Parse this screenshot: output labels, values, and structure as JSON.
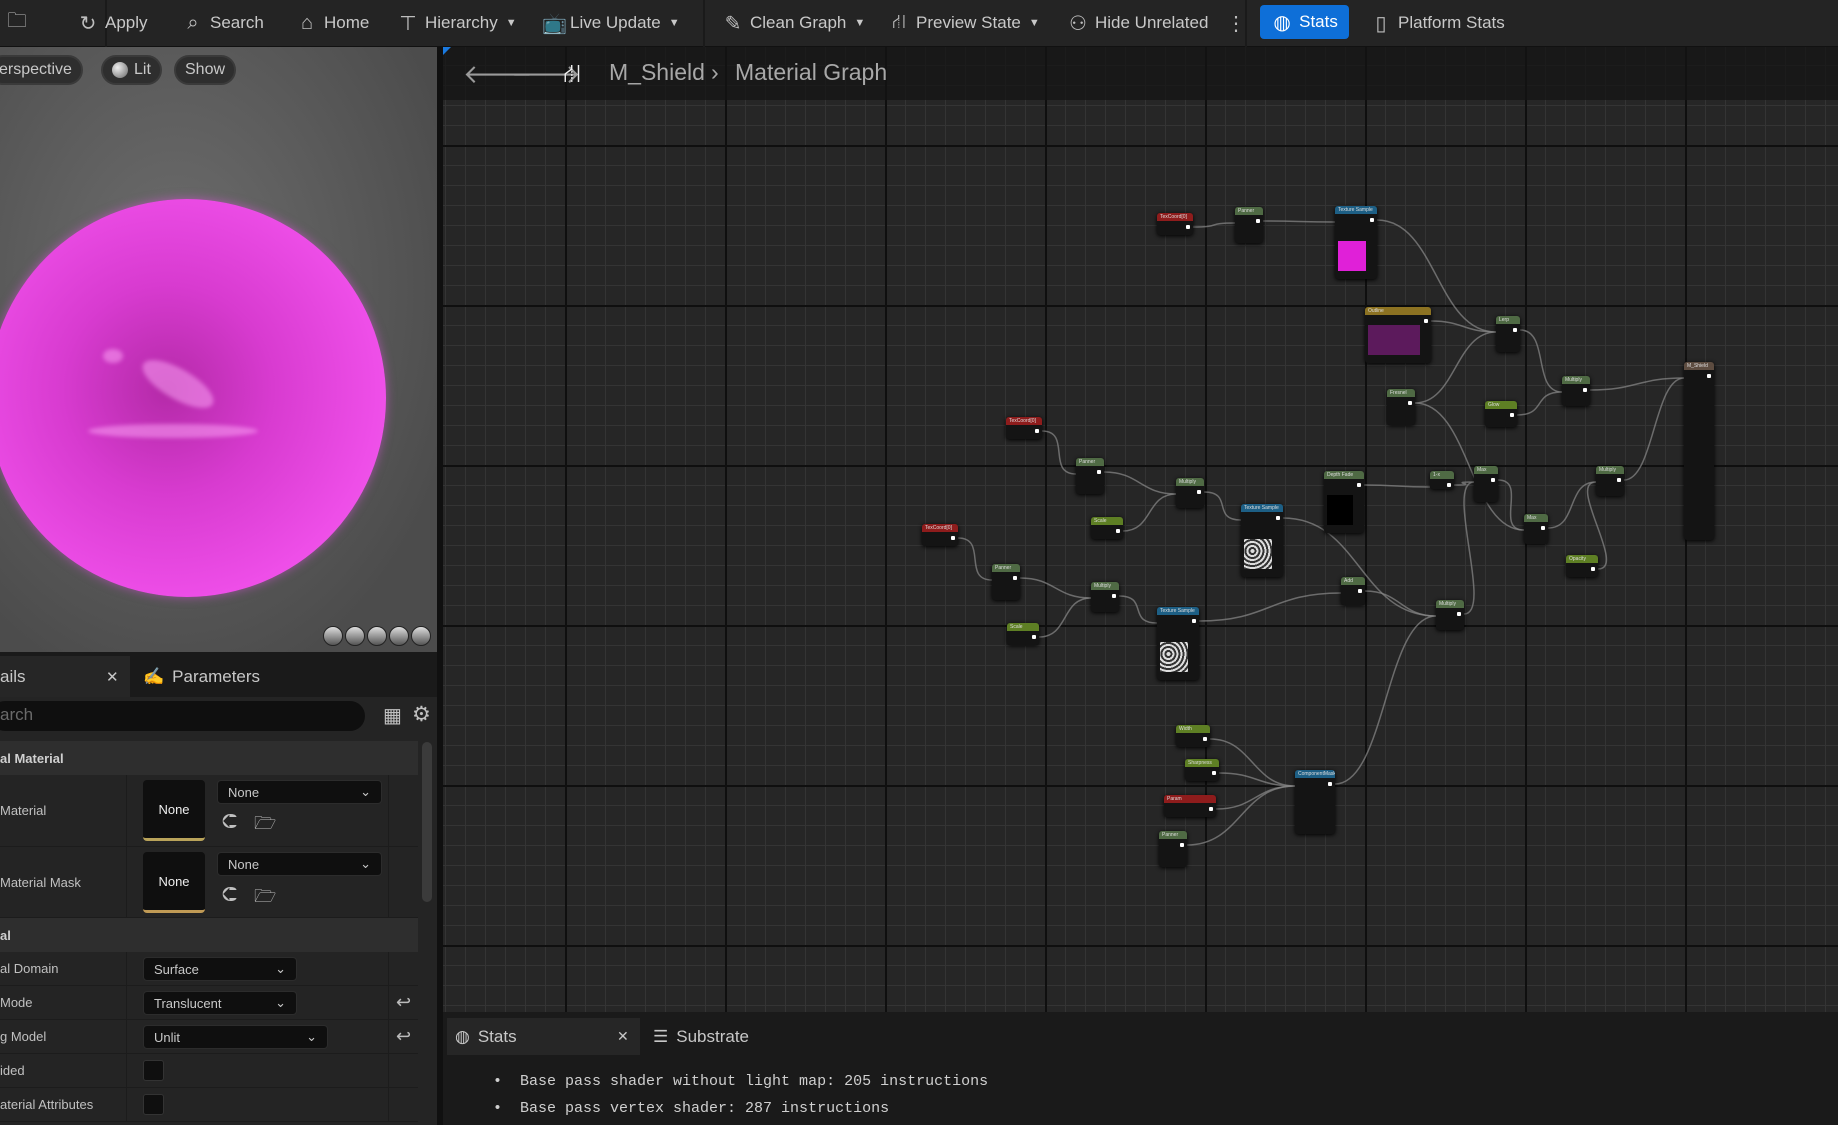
{
  "toolbar": {
    "apply": "Apply",
    "search": "Search",
    "home": "Home",
    "hierarchy": "Hierarchy",
    "live_update": "Live Update",
    "clean_graph": "Clean Graph",
    "preview_state": "Preview State",
    "hide_unrelated": "Hide Unrelated",
    "stats": "Stats",
    "platform_stats": "Platform Stats"
  },
  "viewport": {
    "perspective": "erspective",
    "lit": "Lit",
    "show": "Show"
  },
  "details": {
    "tab_details": "ails",
    "tab_parameters": "Parameters",
    "search_placeholder": "arch",
    "section1": "al Material",
    "row_material": "Material",
    "row_material_value": "None",
    "row_material_thumb": "None",
    "row_mask": "Material Mask",
    "row_mask_value": "None",
    "row_mask_thumb": "None",
    "section2": "al",
    "domain_label": "al Domain",
    "domain_value": "Surface",
    "blend_label": "Mode",
    "blend_value": "Translucent",
    "shading_label": "g Model",
    "shading_value": "Unlit",
    "twosided_label": "ided",
    "attrs_label": "aterial Attributes"
  },
  "graph": {
    "asset": "M_Shield",
    "title": "Material Graph",
    "nodes": [
      {
        "title": "TexCoord[0]",
        "kind": "red"
      },
      {
        "title": "Panner",
        "kind": "green"
      },
      {
        "title": "Texture Sample",
        "kind": "blue",
        "preview": "#e020d8"
      },
      {
        "title": "Outline",
        "kind": "gold",
        "preview": "#5c1a5c"
      },
      {
        "title": "Lerp",
        "kind": "green"
      },
      {
        "title": "Fresnel",
        "kind": "green"
      },
      {
        "title": "Glow",
        "kind": "lime"
      },
      {
        "title": "Multiply",
        "kind": "green"
      },
      {
        "title": "M_Shield",
        "kind": "result"
      },
      {
        "title": "TexCoord[0]",
        "kind": "red"
      },
      {
        "title": "Panner",
        "kind": "green"
      },
      {
        "title": "Multiply",
        "kind": "green"
      },
      {
        "title": "Scale",
        "kind": "lime"
      },
      {
        "title": "Texture Sample",
        "kind": "blue",
        "preview": "noise"
      },
      {
        "title": "Depth Fade",
        "kind": "green",
        "preview": "#000000"
      },
      {
        "title": "1-x",
        "kind": "green"
      },
      {
        "title": "Max",
        "kind": "green"
      },
      {
        "title": "Max",
        "kind": "green"
      },
      {
        "title": "Multiply",
        "kind": "green"
      },
      {
        "title": "Opacity",
        "kind": "lime"
      },
      {
        "title": "TexCoord[0]",
        "kind": "red"
      },
      {
        "title": "Panner",
        "kind": "green"
      },
      {
        "title": "Multiply",
        "kind": "green"
      },
      {
        "title": "Scale",
        "kind": "lime"
      },
      {
        "title": "Texture Sample",
        "kind": "blue",
        "preview": "noise"
      },
      {
        "title": "Add",
        "kind": "green"
      },
      {
        "title": "Multiply",
        "kind": "green"
      },
      {
        "title": "Width",
        "kind": "lime"
      },
      {
        "title": "Sharpness",
        "kind": "lime"
      },
      {
        "title": "Param",
        "kind": "red"
      },
      {
        "title": "Panner",
        "kind": "green"
      },
      {
        "title": "ComponentMask",
        "kind": "blue"
      }
    ]
  },
  "stats": {
    "tab_stats": "Stats",
    "tab_substrate": "Substrate",
    "lines": [
      "Base pass shader without light map: 205 instructions",
      "Base pass vertex shader: 287 instructions"
    ]
  },
  "colors": {
    "accent": "#0e6fd8",
    "sphere": "#e040e0"
  }
}
